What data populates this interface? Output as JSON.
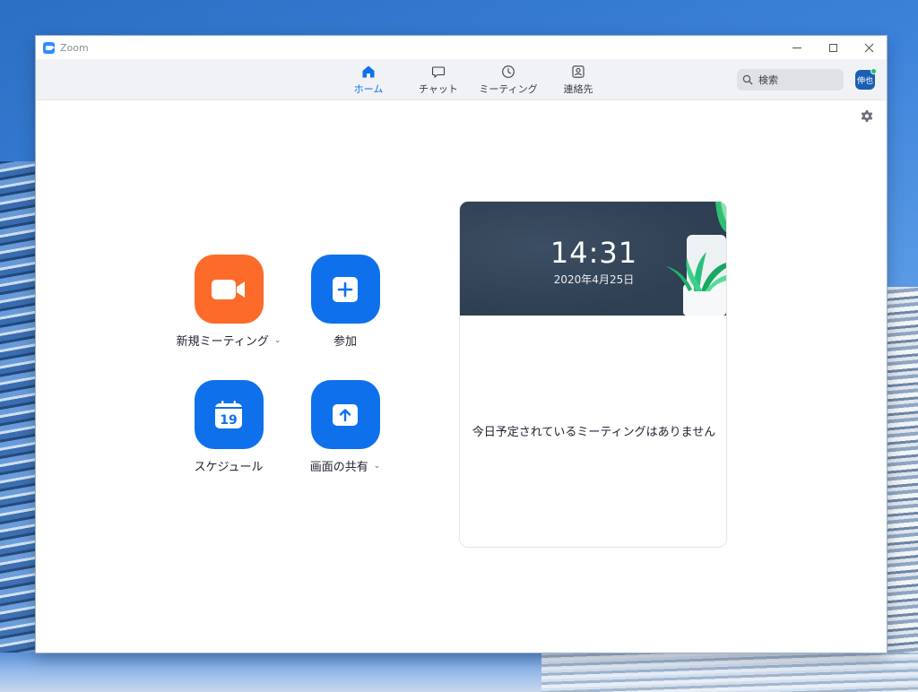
{
  "window": {
    "title": "Zoom"
  },
  "nav": [
    {
      "label": "ホーム",
      "icon": "home-icon",
      "active": true
    },
    {
      "label": "チャット",
      "icon": "chat-icon",
      "active": false
    },
    {
      "label": "ミーティング",
      "icon": "clock-icon",
      "active": false
    },
    {
      "label": "連絡先",
      "icon": "contacts-icon",
      "active": false
    }
  ],
  "search": {
    "placeholder": "検索"
  },
  "user": {
    "avatar_text": "伸也",
    "status_color": "#1fc16b"
  },
  "actions": {
    "new_meeting": {
      "label": "新規ミーティング",
      "icon": "video-camera-icon",
      "color": "#fd6b2a"
    },
    "join": {
      "label": "参加",
      "icon": "plus-icon",
      "color": "#0e71eb"
    },
    "schedule": {
      "label": "スケジュール",
      "icon": "calendar-icon",
      "day": "19",
      "color": "#0e71eb"
    },
    "share_screen": {
      "label": "画面の共有",
      "icon": "share-up-arrow-icon",
      "color": "#0e71eb"
    }
  },
  "clock": {
    "time": "14:31",
    "date": "2020年4月25日"
  },
  "meetings": {
    "empty_text": "今日予定されているミーティングはありません"
  }
}
